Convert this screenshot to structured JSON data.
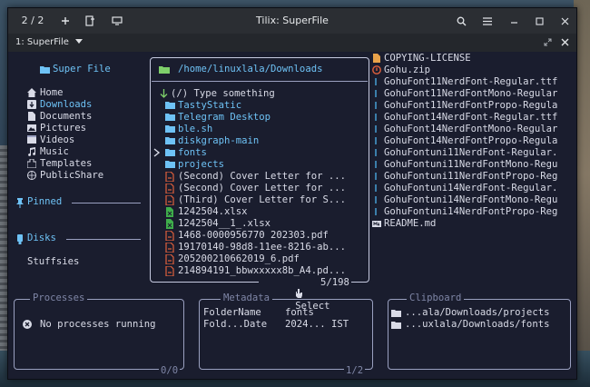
{
  "titlebar": {
    "session_counter": "2 / 2",
    "title": "Tilix: SuperFile",
    "icons": [
      "chevron-down-icon",
      "plus-icon",
      "new-session-icon",
      "sync-input-icon",
      "search-icon",
      "menu-icon",
      "minimize-icon",
      "maximize-icon",
      "close-icon"
    ]
  },
  "tabbar": {
    "tab_label": "1: SuperFile",
    "icons": [
      "dropdown-icon",
      "maximize-terminal-icon",
      "close-terminal-icon"
    ]
  },
  "sidebar": {
    "title": "Super File",
    "items": [
      {
        "label": "Home",
        "icon": "home-icon"
      },
      {
        "label": "Downloads",
        "icon": "download-icon"
      },
      {
        "label": "Documents",
        "icon": "document-icon"
      },
      {
        "label": "Pictures",
        "icon": "picture-icon"
      },
      {
        "label": "Videos",
        "icon": "video-icon"
      },
      {
        "label": "Music",
        "icon": "music-icon"
      },
      {
        "label": "Templates",
        "icon": "template-icon"
      },
      {
        "label": "PublicShare",
        "icon": "share-icon"
      }
    ],
    "pinned_label": "Pinned",
    "disks_label": "Disks",
    "disks": [
      "Stuffsies"
    ]
  },
  "file_panel": {
    "path": "/home/linuxlala/Downloads",
    "search_placeholder": "(/) Type something",
    "entries": [
      {
        "name": "TastyStatic",
        "type": "dir"
      },
      {
        "name": "Telegram Desktop",
        "type": "dir"
      },
      {
        "name": "ble.sh",
        "type": "dir"
      },
      {
        "name": "diskgraph-main",
        "type": "dir"
      },
      {
        "name": "fonts",
        "type": "dir"
      },
      {
        "name": "projects",
        "type": "dir"
      },
      {
        "name": "(Second) Cover Letter for ...",
        "type": "pdf"
      },
      {
        "name": "(Second) Cover Letter for ...",
        "type": "pdf"
      },
      {
        "name": "(Third) Cover Letter for S...",
        "type": "pdf"
      },
      {
        "name": "1242504.xlsx",
        "type": "xlsx"
      },
      {
        "name": "1242504__1_.xlsx",
        "type": "xlsx"
      },
      {
        "name": "1468-0000956770 202303.pdf",
        "type": "pdf"
      },
      {
        "name": "19170140-98d8-11ee-8216-ab...",
        "type": "pdf"
      },
      {
        "name": "205200210662019_6.pdf",
        "type": "pdf"
      },
      {
        "name": "214894191_bbwxxxxx8b_A4.pd...",
        "type": "pdf"
      }
    ],
    "cursor_index": 4,
    "mode_label": "Select",
    "position": "5/198"
  },
  "preview": {
    "entries": [
      {
        "name": "COPYING-LICENSE",
        "icon": "license-icon"
      },
      {
        "name": "Gohu.zip",
        "icon": "zip-icon"
      },
      {
        "name": "GohuFont11NerdFont-Regular.ttf",
        "icon": "font-icon"
      },
      {
        "name": "GohuFont11NerdFontMono-Regular",
        "icon": "font-icon"
      },
      {
        "name": "GohuFont11NerdFontPropo-Regula",
        "icon": "font-icon"
      },
      {
        "name": "GohuFont14NerdFont-Regular.ttf",
        "icon": "font-icon"
      },
      {
        "name": "GohuFont14NerdFontMono-Regular",
        "icon": "font-icon"
      },
      {
        "name": "GohuFont14NerdFontPropo-Regula",
        "icon": "font-icon"
      },
      {
        "name": "GohuFontuni11NerdFont-Regular.",
        "icon": "font-icon"
      },
      {
        "name": "GohuFontuni11NerdFontMono-Regu",
        "icon": "font-icon"
      },
      {
        "name": "GohuFontuni11NerdFontPropo-Reg",
        "icon": "font-icon"
      },
      {
        "name": "GohuFontuni14NerdFont-Regular.",
        "icon": "font-icon"
      },
      {
        "name": "GohuFontuni14NerdFontMono-Regu",
        "icon": "font-icon"
      },
      {
        "name": "GohuFontuni14NerdFontPropo-Reg",
        "icon": "font-icon"
      },
      {
        "name": "README.md",
        "icon": "markdown-icon"
      }
    ]
  },
  "processes": {
    "title": "Processes",
    "empty_text": "No processes running",
    "count": "0/0"
  },
  "metadata": {
    "title": "Metadata",
    "rows": [
      {
        "key": "FolderName",
        "value": "fonts"
      },
      {
        "key": "Fold...Date",
        "value": "2024... IST"
      }
    ],
    "count": "1/2"
  },
  "clipboard": {
    "title": "Clipboard",
    "items": [
      "...ala/Downloads/projects",
      "...uxlala/Downloads/fonts"
    ]
  },
  "colors": {
    "background": "#1a1d2e",
    "border": "#9aa0c0",
    "directory": "#6ec2f5",
    "pdf": "#e0603c",
    "xlsx": "#3fae4b",
    "folder_header": "#7ecf6a"
  }
}
